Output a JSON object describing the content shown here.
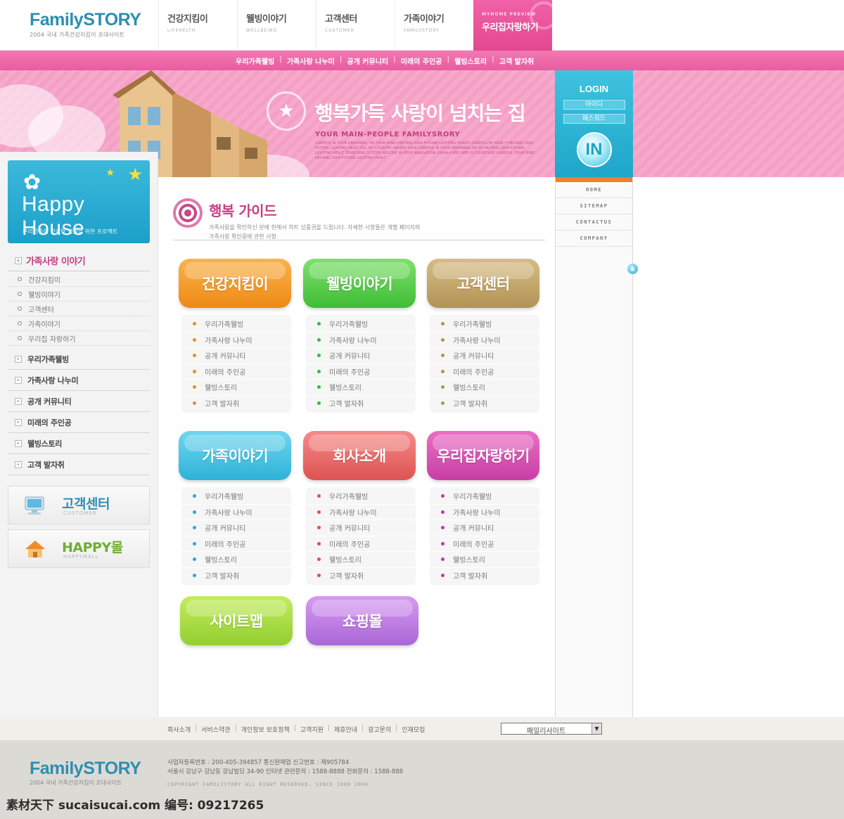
{
  "header": {
    "logo_name": "FamilySTORY",
    "logo_sub": "2004 국내 가족건강지킴이 초대사이트",
    "nav": [
      {
        "label": "건강지킴이",
        "sub": "LIFEHELTH"
      },
      {
        "label": "웰빙이야기",
        "sub": "WELLBEING"
      },
      {
        "label": "고객센터",
        "sub": "CUSTOMER"
      },
      {
        "label": "가족이야기",
        "sub": "FAMILYSTORY"
      }
    ],
    "special": {
      "label": "우리집자랑하기",
      "sub": "MYHOME PREVIEW"
    }
  },
  "subnav": [
    "우리가족웰빙",
    "가족사랑 나누미",
    "공개 커뮤니티",
    "미래의 주인공",
    "웰빙스토리",
    "고객 발자취"
  ],
  "banner": {
    "title": "행복가득 사랑이 넘치는 집",
    "tagline": "YOUR MAIN-PEOPLE FAMILYSRORY",
    "small_text": "CAREFUL IN YOUR DREAMING. ON YOUR MIND HELPING 2004 FUTURE LIGHTING HEALTH CAREFUL IN YOUR 3 HELPING 2004 FUTURE LIGHTING HEALT FILL MY COUNTRY HAVING YOUR CAREFUL IN YOUR DREAMING ON YO HELPING 2004 FUTURE LIGHTING HEALT TEARCHING SYSTEM WELCME IN YOUR NAVIGATION 2004A-4 KBS WER IS COUNTIURE CAREFUL. YOUR MIND HELPING 2004 FUTURE LIGHTING HEALT"
  },
  "login": {
    "title": "LOGIN",
    "id_label": "아이디",
    "pw_label": "패스워드",
    "button": "IN"
  },
  "sidebar": {
    "banner_title": "Happy House",
    "banner_desc": "우리가족의 건강한 생활을 위한 프로젝트",
    "section_title": "가족사랑 이야기",
    "sub_items": [
      "건강지킴이",
      "웰빙이야기",
      "고객센터",
      "가족이야기",
      "우리집 자랑하기"
    ],
    "main_items": [
      "우리가족웰빙",
      "가족사랑 나누미",
      "공개 커뮤니티",
      "미래의 주인공",
      "웰빙스토리",
      "고객 발자취"
    ],
    "quick": [
      {
        "title": "고객센터",
        "sub": "CUSTOMER",
        "color": "#2f8fb6"
      },
      {
        "title": "HAPPY몰",
        "sub": "HAPPYMALL",
        "color": "#6fae32"
      }
    ]
  },
  "content": {
    "title": "행복 가이드",
    "desc1": "가족사랑을 확인하신 분에 한해서 하트 상품권을 드립니다. 자세한 사항들은 개별 페이지의",
    "desc2": "가족사랑 확인증에 관한 사항",
    "cards": [
      {
        "label": "건강지킴이",
        "color_top": "#fbb24d",
        "color_bottom": "#ee8a14",
        "dot": "#f28a1e"
      },
      {
        "label": "웰빙이야기",
        "color_top": "#7ee06c",
        "color_bottom": "#3fbd36",
        "dot": "#3fb53a"
      },
      {
        "label": "고객센터",
        "color_top": "#d6bd85",
        "color_bottom": "#b39356",
        "dot": "#b09457"
      },
      {
        "label": "가족이야기",
        "color_top": "#6fd6ef",
        "color_bottom": "#2eb2d8",
        "dot": "#2ba8d4"
      },
      {
        "label": "회사소개",
        "color_top": "#f58b89",
        "color_bottom": "#dd5352",
        "dot": "#e04e4e"
      },
      {
        "label": "우리집자랑하기",
        "color_top": "#ea6fc4",
        "color_bottom": "#c63ea5",
        "dot": "#c23a9f"
      }
    ],
    "card_items": [
      "우리가족웰빙",
      "가족사랑 나누미",
      "공개 커뮤니티",
      "미래의 주인공",
      "웰빙스토리",
      "고객 발자취"
    ],
    "extra_buttons": [
      {
        "label": "사이트맵",
        "color_top": "#c3ec5e",
        "color_bottom": "#92cf31"
      },
      {
        "label": "쇼핑몰",
        "color_top": "#d79af0",
        "color_bottom": "#a967d6"
      }
    ]
  },
  "right_menu": [
    "HOME",
    "SITEMAP",
    "CONTACTUS",
    "COMPANY"
  ],
  "footer": {
    "links": [
      "회사소개",
      "서비스약관",
      "개인정보 보호정책",
      "고객지원",
      "제휴안내",
      "광고문의",
      "인재모집"
    ],
    "family_site": "패밀리사이트",
    "info1": "사업자등록번호 : 200-405-394857   통신판매업 신고번호 : 제905784",
    "info2": "서울시 강남구 강남동 강남빌딩 34-90  인터넷 관련문의 : 1588-8888 전화문의 : 1588-888",
    "copyright": "COPYRIGHT FAMILYSTORY ALL RIGHT RESERVED. SINCE 1900 2004"
  },
  "watermark": "素材天下 sucaisucai.com  编号: 09217265"
}
